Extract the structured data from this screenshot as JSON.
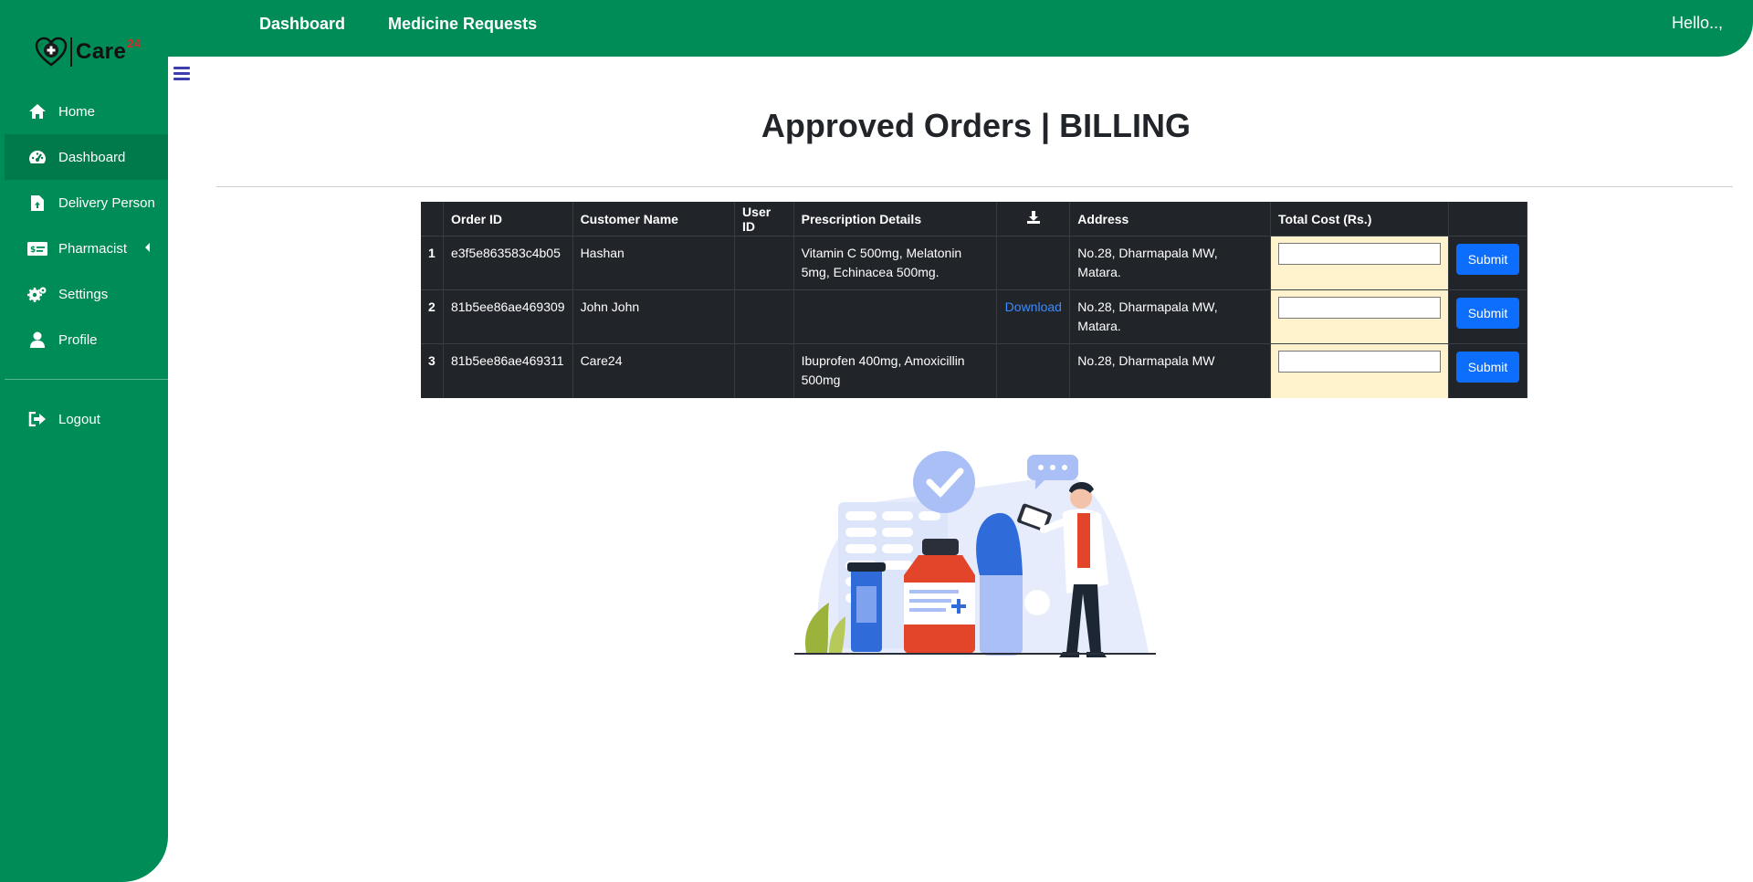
{
  "brand": {
    "name": "Care",
    "sup": "24"
  },
  "sidebar": {
    "items": [
      {
        "label": "Home",
        "icon": "home-icon"
      },
      {
        "label": "Dashboard",
        "icon": "gauge-icon",
        "active": true
      },
      {
        "label": "Delivery Person",
        "icon": "file-upload-icon"
      },
      {
        "label": "Pharmacist",
        "icon": "money-check-icon",
        "has_caret": true
      },
      {
        "label": "Settings",
        "icon": "gears-icon"
      },
      {
        "label": "Profile",
        "icon": "user-icon"
      }
    ],
    "logout": {
      "label": "Logout",
      "icon": "sign-out-icon"
    }
  },
  "header": {
    "links": [
      "Dashboard",
      "Medicine Requests"
    ],
    "greeting": "Hello..,"
  },
  "page": {
    "title": "Approved Orders | BILLING"
  },
  "table": {
    "columns": [
      "",
      "Order ID",
      "Customer Name",
      "User ID",
      "Prescription Details",
      "download-icon",
      "Address",
      "Total Cost (Rs.)",
      ""
    ],
    "rows": [
      {
        "num": "1",
        "order_id": "e3f5e863583c4b05",
        "customer": "Hashan",
        "user_id": "",
        "prescription": "Vitamin C 500mg, Melatonin 5mg, Echinacea 500mg.",
        "download": "",
        "address": "No.28, Dharmapala MW, Matara.",
        "total_cost": "",
        "action": "Submit"
      },
      {
        "num": "2",
        "order_id": "81b5ee86ae469309",
        "customer": "John John",
        "user_id": "",
        "prescription": "",
        "download": "Download",
        "address": "No.28, Dharmapala MW, Matara.",
        "total_cost": "",
        "action": "Submit"
      },
      {
        "num": "3",
        "order_id": "81b5ee86ae469311",
        "customer": "Care24",
        "user_id": "",
        "prescription": "Ibuprofen 400mg, Amoxicillin 500mg",
        "download": "",
        "address": "No.28, Dharmapala MW",
        "total_cost": "",
        "action": "Submit"
      }
    ]
  },
  "colors": {
    "brand_green": "#008c57",
    "table_dark": "#212529",
    "cost_cell": "#fff3cd",
    "button_blue": "#0d6efd"
  }
}
